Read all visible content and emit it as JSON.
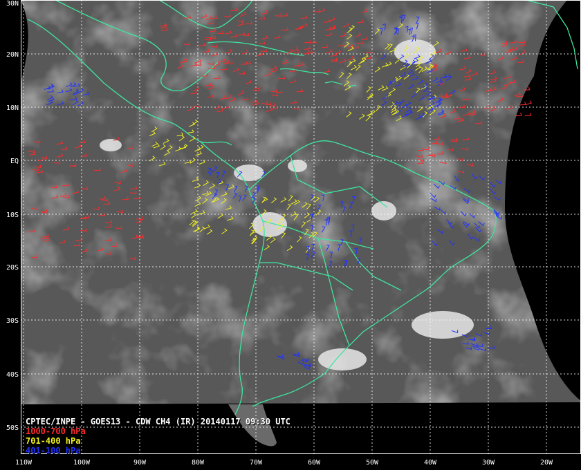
{
  "map": {
    "latitude_labels": [
      "30N",
      "20N",
      "10N",
      "EQ",
      "10S",
      "20S",
      "30S",
      "40S",
      "50S"
    ],
    "longitude_labels": [
      "110W",
      "100W",
      "90W",
      "80W",
      "70W",
      "60W",
      "50W",
      "40W",
      "30W",
      "20W"
    ],
    "colors": {
      "background": "#000000",
      "imagery_base": "#585858",
      "coastline": "#3ee6a0",
      "grid": "#ffffff",
      "text": "#ffffff"
    }
  },
  "caption": {
    "title": "CPTEC/INPE - GOES13 - CDW CH4 (IR) 20140117 09:30 UTC",
    "legend": [
      {
        "label": "1000-700 hPa",
        "color": "#ff2a2a"
      },
      {
        "label": "701-400 hPa",
        "color": "#f0f020"
      },
      {
        "label": "401-100 hPa",
        "color": "#2233ff"
      }
    ]
  }
}
